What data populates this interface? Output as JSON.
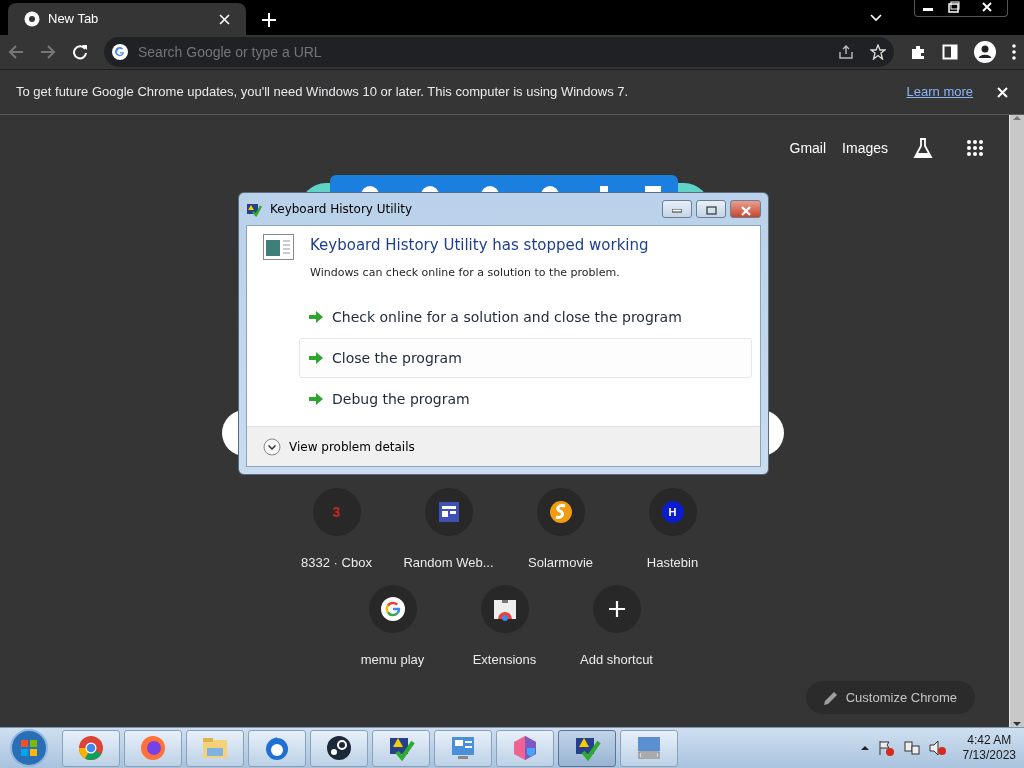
{
  "tab": {
    "title": "New Tab",
    "selected": true
  },
  "address_bar": {
    "placeholder": "Search Google or type a URL"
  },
  "infobar": {
    "message": "To get future Google Chrome updates, you'll need Windows 10 or later. This computer is using Windows 7.",
    "link": "Learn more"
  },
  "top_links": [
    "Gmail",
    "Images"
  ],
  "shortcuts": [
    {
      "label": "8332 · Cbox",
      "kind": "letter",
      "glyph": "3",
      "color": "#c62828"
    },
    {
      "label": "Random Web...",
      "kind": "tiles"
    },
    {
      "label": "Solarmovie",
      "kind": "solar"
    },
    {
      "label": "Hastebin",
      "kind": "badge",
      "glyph": "H",
      "color": "#0a1ccc"
    },
    {
      "label": "memu play",
      "kind": "google"
    },
    {
      "label": "Extensions",
      "kind": "store"
    },
    {
      "label": "Add shortcut",
      "kind": "add"
    }
  ],
  "customize_button": "Customize Chrome",
  "dialog": {
    "title": "Keyboard History Utility",
    "heading": "Keyboard History Utility has stopped working",
    "message": "Windows can check online for a solution to the problem.",
    "options": [
      {
        "label": "Check online for a solution and close the program",
        "hovered": false
      },
      {
        "label": "Close the program",
        "hovered": true
      },
      {
        "label": "Debug the program",
        "hovered": false
      }
    ],
    "details": "View problem details"
  },
  "taskbar": {
    "items": [
      {
        "kind": "chrome",
        "active": false
      },
      {
        "kind": "firefox",
        "active": false
      },
      {
        "kind": "folder",
        "active": false
      },
      {
        "kind": "thunderbird",
        "active": false
      },
      {
        "kind": "steam",
        "active": false
      },
      {
        "kind": "checkdoc",
        "active": false
      },
      {
        "kind": "panel",
        "active": false
      },
      {
        "kind": "shield",
        "active": false
      },
      {
        "kind": "checkdoc",
        "active": true
      },
      {
        "kind": "keyboard",
        "active": false
      }
    ],
    "time": "4:42 AM",
    "date": "7/13/2023"
  }
}
